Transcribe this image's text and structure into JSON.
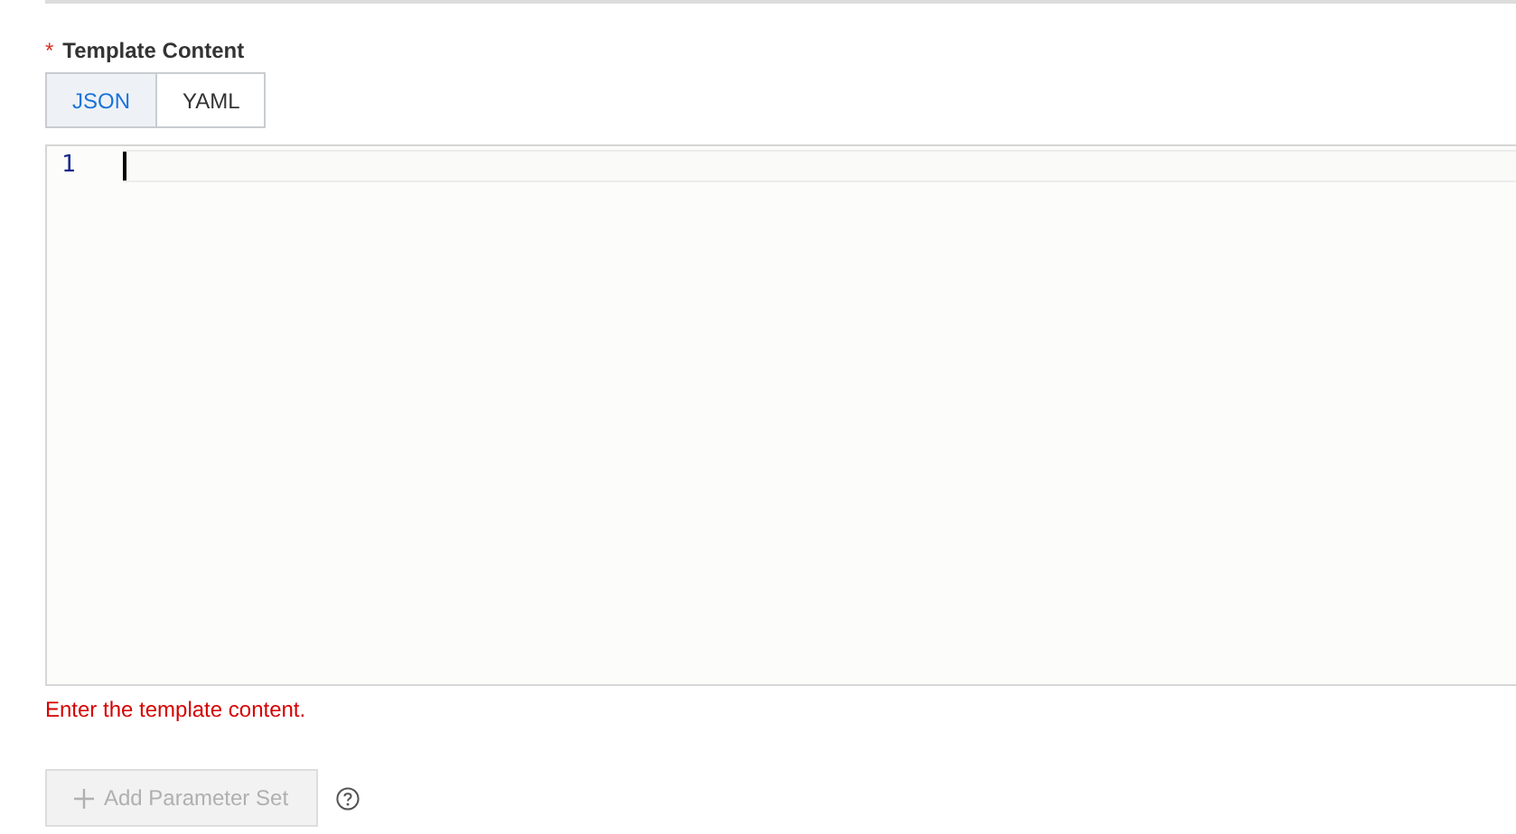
{
  "field": {
    "required_mark": "*",
    "label": "Template Content"
  },
  "tabs": [
    {
      "label": "JSON",
      "selected": true
    },
    {
      "label": "YAML",
      "selected": false
    }
  ],
  "editor": {
    "lines": [
      {
        "number": "1",
        "active": true
      }
    ]
  },
  "error": "Enter the template content.",
  "add_button": {
    "label": "Add Parameter Set",
    "disabled": true
  }
}
